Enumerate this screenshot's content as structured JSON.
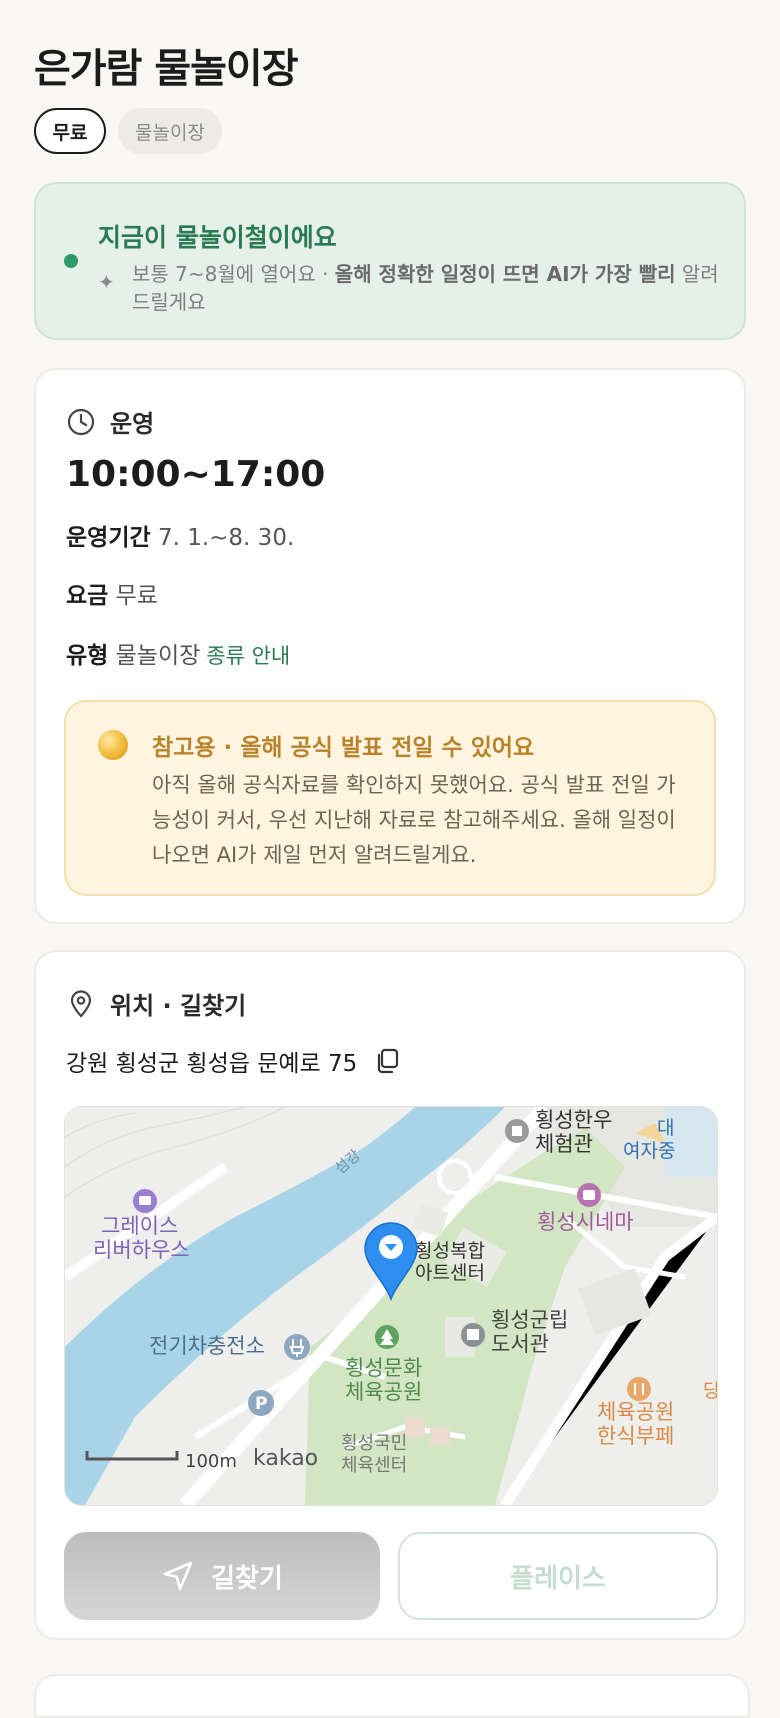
{
  "title": "은가람 물놀이장",
  "chips": {
    "free": "무료",
    "type": "물놀이장"
  },
  "season": {
    "headline": "지금이 물놀이철이에요",
    "desc_prefix": "보통 7~8월에 열어요 · ",
    "desc_bold": "올해 정확한 일정이 뜨면 AI가 가장 빨리",
    "desc_suffix": " 알려드릴게요"
  },
  "operation": {
    "section_title": "운영",
    "hours": "10:00~17:00",
    "period_label": "운영기간",
    "period_value": "7. 1.~8. 30.",
    "fee_label": "요금",
    "fee_value": "무료",
    "type_label": "유형",
    "type_value": "물놀이장",
    "type_link": "종류 안내",
    "notice": {
      "headline": "참고용 · 올해 공식 발표 전일 수 있어요",
      "body": "아직 올해 공식자료를 확인하지 못했어요. 공식 발표 전일 가능성이 커서, 우선 지난해 자료로 참고해주세요. 올해 일정이 나오면 AI가 제일 먼저 알려드릴게요."
    }
  },
  "location": {
    "section_title": "위치 · 길찾기",
    "address": "강원 횡성군 횡성읍 문예로 75",
    "map": {
      "labels": {
        "river": "섬강",
        "hanwoo": "횡성한우",
        "hanwoo2": "체험관",
        "school1": "대",
        "school2": "여자중",
        "grace1": "그레이스",
        "grace2": "리버하우스",
        "cinema": "횡성시네마",
        "artcenter1": "횡성복합",
        "artcenter2": "아트센터",
        "library1": "횡성군립",
        "library2": "도서관",
        "ev": "전기차충전소",
        "park1": "횡성문화",
        "park2": "체육공원",
        "buffet1": "체육공원",
        "buffet2": "한식부페",
        "sports1": "횡성국민",
        "sports2": "체육센터",
        "edge": "당",
        "scale": "100m",
        "brand": "kakao"
      },
      "colors": {
        "land": "#eeeeec",
        "green": "#d3e6c3",
        "water": "#a9d4e8",
        "road": "#ffffff",
        "pin": "#2d8ef0"
      }
    },
    "buttons": {
      "directions": "길찾기",
      "place": "플레이스"
    }
  }
}
